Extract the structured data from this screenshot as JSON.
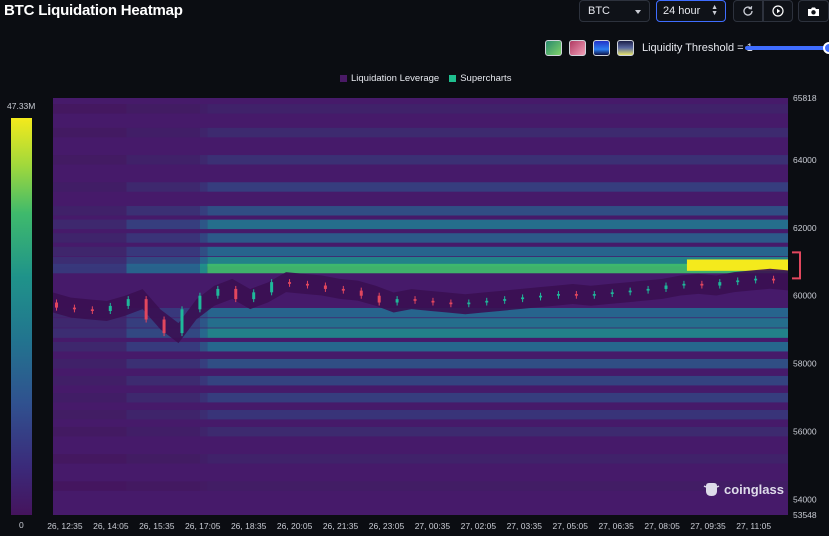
{
  "app": {
    "title": "BTC Liquidation Heatmap"
  },
  "controls": {
    "coin": "BTC",
    "range": "24 hour",
    "threshold_label": "Liquidity Threshold = 1",
    "threshold_value": 1
  },
  "colorbar": {
    "max_label": "47.33M",
    "min_label": "0"
  },
  "watermark": "coinglass",
  "colors": {
    "accent": "#3f6dff",
    "heat_low": "#45145d",
    "heat_mid": "#22748f",
    "heat_high": "#f4ea1c",
    "candle_up": "#1fb89a",
    "candle_down": "#e2475e"
  },
  "chart_data": {
    "type": "heatmap",
    "title": "",
    "legend": [
      {
        "name": "Liquidation Leverage",
        "color": "#4a1a66"
      },
      {
        "name": "Supercharts",
        "color": "#1fbf8f"
      }
    ],
    "legend_placement": "top",
    "x_labels": [
      "26, 12:35",
      "26, 14:05",
      "26, 15:35",
      "26, 17:05",
      "26, 18:35",
      "26, 20:05",
      "26, 21:35",
      "26, 23:05",
      "27, 00:35",
      "27, 02:05",
      "27, 03:35",
      "27, 05:05",
      "27, 06:35",
      "27, 08:05",
      "27, 09:35",
      "27, 11:05"
    ],
    "y_ticks": [
      54000,
      56000,
      58000,
      60000,
      62000,
      64000
    ],
    "y_range": [
      53548,
      65818
    ],
    "y_range_labels": [
      "53548",
      "65818"
    ],
    "colorscale_range": [
      0,
      47330000
    ],
    "liquidation_bands": [
      {
        "price": 65500,
        "intensity": 0.08
      },
      {
        "price": 64800,
        "intensity": 0.12
      },
      {
        "price": 64000,
        "intensity": 0.15
      },
      {
        "price": 63200,
        "intensity": 0.22
      },
      {
        "price": 62500,
        "intensity": 0.3
      },
      {
        "price": 62100,
        "intensity": 0.45
      },
      {
        "price": 61700,
        "intensity": 0.35
      },
      {
        "price": 61300,
        "intensity": 0.4
      },
      {
        "price": 61000,
        "intensity": 0.55
      },
      {
        "price": 60800,
        "intensity": 0.78
      },
      {
        "price": 59500,
        "intensity": 0.4
      },
      {
        "price": 59200,
        "intensity": 0.45
      },
      {
        "price": 58900,
        "intensity": 0.55
      },
      {
        "price": 58500,
        "intensity": 0.42
      },
      {
        "price": 58000,
        "intensity": 0.3
      },
      {
        "price": 57500,
        "intensity": 0.25
      },
      {
        "price": 57000,
        "intensity": 0.22
      },
      {
        "price": 56500,
        "intensity": 0.18
      },
      {
        "price": 56000,
        "intensity": 0.12
      },
      {
        "price": 55200,
        "intensity": 0.08
      },
      {
        "price": 54400,
        "intensity": 0.05
      }
    ],
    "peak_band": {
      "price": 60900,
      "intensity": 1.0,
      "from_label": "27, 08:05"
    },
    "price_series": [
      59800,
      59650,
      59600,
      59550,
      59700,
      59900,
      59300,
      58900,
      59600,
      60000,
      60200,
      59900,
      60100,
      60400,
      60350,
      60300,
      60200,
      60150,
      60000,
      59800,
      59900,
      59850,
      59800,
      59750,
      59800,
      59850,
      59900,
      59950,
      60000,
      60050,
      60000,
      60050,
      60100,
      60150,
      60200,
      60300,
      60350,
      60300,
      60400,
      60450,
      60500,
      60450
    ]
  }
}
